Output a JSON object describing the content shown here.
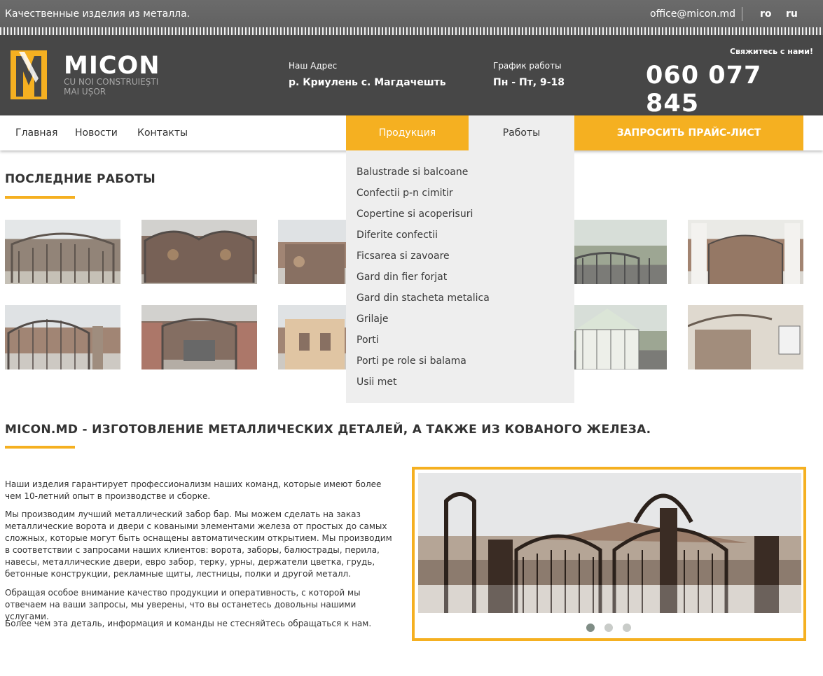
{
  "topbar": {
    "tagline": "Качественные изделия из металла.",
    "email": "office@micon.md",
    "languages": [
      "ro",
      "ru"
    ]
  },
  "header": {
    "brand": "MICON",
    "slogan_line1": "CU NOI CONSTRUIEȘTI",
    "slogan_line2": "MAI UȘOR",
    "address_label": "Наш Адрес",
    "address_value": "р. Криулень с. Магдачешть",
    "schedule_label": "График работы",
    "schedule_value": "Пн - Пт, 9-18",
    "contact_label": "Свяжитесь с нами!",
    "phone": "060 077 845"
  },
  "nav": {
    "home": "Главная",
    "news": "Новости",
    "contacts": "Контакты",
    "products": "Продукция",
    "works": "Работы",
    "price_request": "ЗАПРОСИТЬ ПРАЙС-ЛИСТ"
  },
  "dropdown": {
    "items": [
      "Balustrade si balcoane",
      "Confectii p-n cimitir",
      "Copertine si acoperisuri",
      "Diferite confectii",
      "Ficsarea si zavoare",
      "Gard din fier forjat",
      "Gard din stacheta metalica",
      "Grilaje",
      "Porti",
      "Porti pe role si balama",
      "Usii met"
    ]
  },
  "latest_works": {
    "title": "ПОСЛЕДНИЕ РАБОТЫ"
  },
  "about": {
    "title": "MICON.MD - ИЗГОТОВЛЕНИЕ МЕТАЛЛИЧЕСКИХ ДЕТАЛЕЙ, А ТАКЖЕ ИЗ КОВАНОГО ЖЕЛЕЗА.",
    "p1": "Наши изделия гарантирует профессионализм наших команд, которые имеют более чем 10-летний опыт в производстве и сборке.",
    "p2": "Мы производим лучший металлический забор бар. Мы можем сделать на заказ металлические ворота и двери с коваными элементами железа от простых до самых сложных, которые могут быть оснащены автоматическим открытием. Мы производим в соответствии с запросами наших клиентов: ворота, заборы, балюстрады, перила, навесы, металлические двери, евро забор, терку, урны, держатели цветка, грудь, бетонные конструкции, рекламные щиты, лестницы, полки и другой металл.",
    "p3": "Обращая особое внимание качество продукции и оперативность, с которой мы отвечаем на ваши запросы, мы уверены, что вы останетесь довольны нашими услугами.",
    "p4": "Более чем эта деталь, информация и команды не стесняйтесь обращаться к нам."
  },
  "slider": {
    "slide_count": 3,
    "active_index": 0
  },
  "colors": {
    "accent": "#f5b021",
    "header_bg": "#474747",
    "topbar_bg": "#636363",
    "dropdown_bg": "#eeeeee"
  }
}
